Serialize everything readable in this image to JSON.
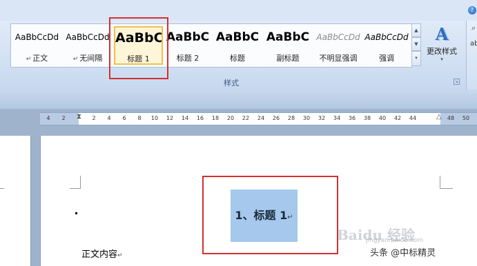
{
  "styles_gallery": {
    "items": [
      {
        "sample": "AaBbCcDd",
        "label": "正文",
        "has_mark": true
      },
      {
        "sample": "AaBbCcDd",
        "label": "无间隔",
        "has_mark": true
      },
      {
        "sample": "AaBbC",
        "label": "标题 1",
        "selected": true
      },
      {
        "sample": "AaBbC",
        "label": "标题 2"
      },
      {
        "sample": "AaBbC",
        "label": "标题"
      },
      {
        "sample": "AaBbC",
        "label": "副标题"
      },
      {
        "sample": "AaBbCcDd",
        "label": "不明显强调"
      },
      {
        "sample": "AaBbCcDd",
        "label": "强调"
      }
    ],
    "paragraph_mark": "↵",
    "group_caption": "样式",
    "change_styles_label": "更改样式",
    "change_styles_icon": "A",
    "dialog_launcher": "↘"
  },
  "ruler": {
    "ticks": [
      "4",
      "2",
      "2",
      "4",
      "6",
      "8",
      "10",
      "12",
      "14",
      "16",
      "18",
      "20",
      "22",
      "24",
      "26",
      "28",
      "30",
      "32",
      "34",
      "36",
      "38",
      "40",
      "42",
      "44",
      "48",
      "50"
    ]
  },
  "document": {
    "heading_text": "1、标题 1",
    "body_text": "正文内容",
    "paragraph_mark": "↵"
  },
  "overlay": {
    "watermark": "Baidu 经验",
    "watermark_sub": "jingyan.baidu.com",
    "credit": "头条 @中标精灵"
  },
  "colors": {
    "highlight_box": "#d32f2f",
    "selection": "#a5c8ec",
    "selected_style_border": "#f0c049"
  },
  "icons": {
    "help": "?",
    "scroll_up": "▲",
    "scroll_down": "▼",
    "more": "▾"
  }
}
